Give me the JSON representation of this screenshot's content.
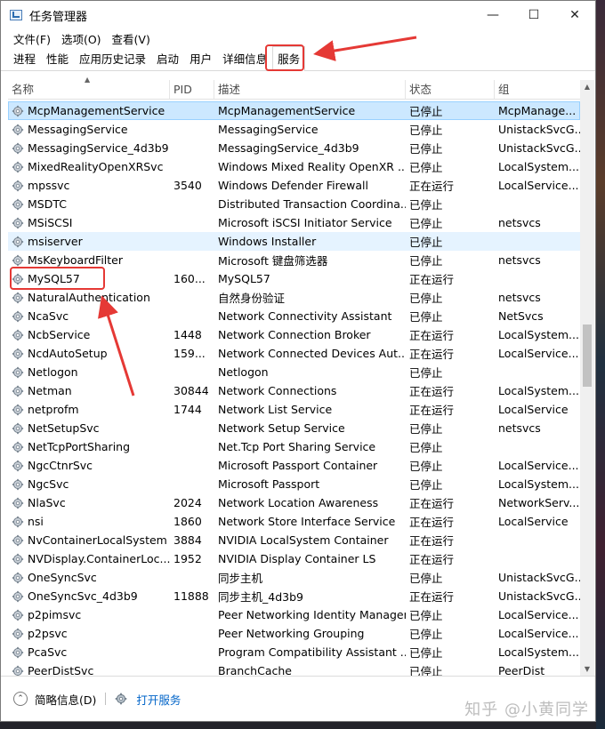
{
  "window": {
    "title": "任务管理器",
    "controls": {
      "minimize": "—",
      "maximize": "☐",
      "close": "✕"
    }
  },
  "menubar": [
    "文件(F)",
    "选项(O)",
    "查看(V)"
  ],
  "tabs": [
    "进程",
    "性能",
    "应用历史记录",
    "启动",
    "用户",
    "详细信息",
    "服务"
  ],
  "active_tab": "服务",
  "columns": [
    "名称",
    "PID",
    "描述",
    "状态",
    "组"
  ],
  "rows": [
    {
      "name": "McpManagementService",
      "pid": "",
      "desc": "McpManagementService",
      "status": "已停止",
      "group": "McpManage..."
    },
    {
      "name": "MessagingService",
      "pid": "",
      "desc": "MessagingService",
      "status": "已停止",
      "group": "UnistackSvcG..."
    },
    {
      "name": "MessagingService_4d3b9",
      "pid": "",
      "desc": "MessagingService_4d3b9",
      "status": "已停止",
      "group": "UnistackSvcG..."
    },
    {
      "name": "MixedRealityOpenXRSvc",
      "pid": "",
      "desc": "Windows Mixed Reality OpenXR ...",
      "status": "已停止",
      "group": "LocalSystem..."
    },
    {
      "name": "mpssvc",
      "pid": "3540",
      "desc": "Windows Defender Firewall",
      "status": "正在运行",
      "group": "LocalService..."
    },
    {
      "name": "MSDTC",
      "pid": "",
      "desc": "Distributed Transaction Coordina...",
      "status": "已停止",
      "group": ""
    },
    {
      "name": "MSiSCSI",
      "pid": "",
      "desc": "Microsoft iSCSI Initiator Service",
      "status": "已停止",
      "group": "netsvcs"
    },
    {
      "name": "msiserver",
      "pid": "",
      "desc": "Windows Installer",
      "status": "已停止",
      "group": ""
    },
    {
      "name": "MsKeyboardFilter",
      "pid": "",
      "desc": "Microsoft 键盘筛选器",
      "status": "已停止",
      "group": "netsvcs"
    },
    {
      "name": "MySQL57",
      "pid": "160...",
      "desc": "MySQL57",
      "status": "正在运行",
      "group": ""
    },
    {
      "name": "NaturalAuthentication",
      "pid": "",
      "desc": "自然身份验证",
      "status": "已停止",
      "group": "netsvcs"
    },
    {
      "name": "NcaSvc",
      "pid": "",
      "desc": "Network Connectivity Assistant",
      "status": "已停止",
      "group": "NetSvcs"
    },
    {
      "name": "NcbService",
      "pid": "1448",
      "desc": "Network Connection Broker",
      "status": "正在运行",
      "group": "LocalSystem..."
    },
    {
      "name": "NcdAutoSetup",
      "pid": "159...",
      "desc": "Network Connected Devices Aut...",
      "status": "正在运行",
      "group": "LocalService..."
    },
    {
      "name": "Netlogon",
      "pid": "",
      "desc": "Netlogon",
      "status": "已停止",
      "group": ""
    },
    {
      "name": "Netman",
      "pid": "30844",
      "desc": "Network Connections",
      "status": "正在运行",
      "group": "LocalSystem..."
    },
    {
      "name": "netprofm",
      "pid": "1744",
      "desc": "Network List Service",
      "status": "正在运行",
      "group": "LocalService"
    },
    {
      "name": "NetSetupSvc",
      "pid": "",
      "desc": "Network Setup Service",
      "status": "已停止",
      "group": "netsvcs"
    },
    {
      "name": "NetTcpPortSharing",
      "pid": "",
      "desc": "Net.Tcp Port Sharing Service",
      "status": "已停止",
      "group": ""
    },
    {
      "name": "NgcCtnrSvc",
      "pid": "",
      "desc": "Microsoft Passport Container",
      "status": "已停止",
      "group": "LocalService..."
    },
    {
      "name": "NgcSvc",
      "pid": "",
      "desc": "Microsoft Passport",
      "status": "已停止",
      "group": "LocalSystem..."
    },
    {
      "name": "NlaSvc",
      "pid": "2024",
      "desc": "Network Location Awareness",
      "status": "正在运行",
      "group": "NetworkServ..."
    },
    {
      "name": "nsi",
      "pid": "1860",
      "desc": "Network Store Interface Service",
      "status": "正在运行",
      "group": "LocalService"
    },
    {
      "name": "NvContainerLocalSystem",
      "pid": "3884",
      "desc": "NVIDIA LocalSystem Container",
      "status": "正在运行",
      "group": ""
    },
    {
      "name": "NVDisplay.ContainerLoc...",
      "pid": "1952",
      "desc": "NVIDIA Display Container LS",
      "status": "正在运行",
      "group": ""
    },
    {
      "name": "OneSyncSvc",
      "pid": "",
      "desc": "同步主机",
      "status": "已停止",
      "group": "UnistackSvcG..."
    },
    {
      "name": "OneSyncSvc_4d3b9",
      "pid": "11888",
      "desc": "同步主机_4d3b9",
      "status": "正在运行",
      "group": "UnistackSvcG..."
    },
    {
      "name": "p2pimsvc",
      "pid": "",
      "desc": "Peer Networking Identity Manager",
      "status": "已停止",
      "group": "LocalService..."
    },
    {
      "name": "p2psvc",
      "pid": "",
      "desc": "Peer Networking Grouping",
      "status": "已停止",
      "group": "LocalService..."
    },
    {
      "name": "PcaSvc",
      "pid": "",
      "desc": "Program Compatibility Assistant ...",
      "status": "已停止",
      "group": "LocalSystem..."
    },
    {
      "name": "PeerDistSvc",
      "pid": "",
      "desc": "BranchCache",
      "status": "已停止",
      "group": "PeerDist"
    }
  ],
  "footer": {
    "collapse_label": "简略信息(D)",
    "open_services_label": "打开服务"
  },
  "watermark": "知乎 @小黄同学",
  "colors": {
    "selected_row": "#cce8ff",
    "hover_row": "#e5f3ff",
    "annotation": "#e53935",
    "link": "#0064c8"
  }
}
